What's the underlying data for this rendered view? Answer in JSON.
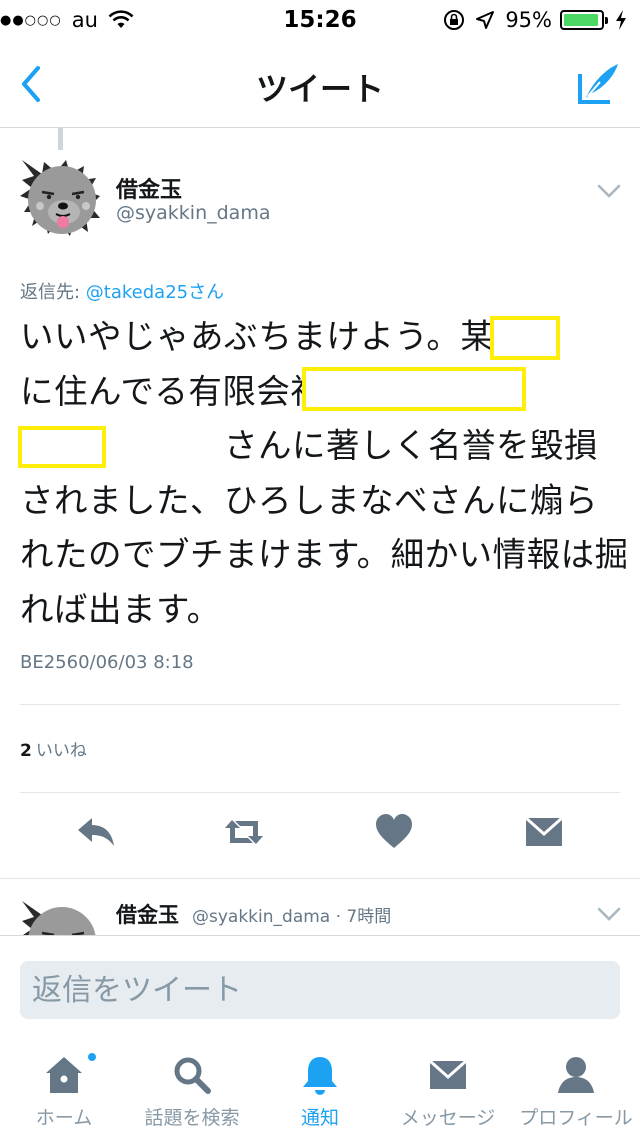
{
  "status_bar": {
    "signal": "●●○○○",
    "carrier": "au",
    "time": "15:26",
    "battery_percent": "95%",
    "battery_level": 0.95,
    "icons": [
      "wifi-icon",
      "rotation-lock-icon",
      "location-icon",
      "battery-icon",
      "charging-icon"
    ]
  },
  "nav": {
    "title": "ツイート",
    "back_icon": "chevron-left-icon",
    "compose_icon": "compose-tweet-icon"
  },
  "tweet": {
    "author_name": "借金玉",
    "author_handle": "@syakkin_dama",
    "reply_label": "返信先: ",
    "reply_mention": "@takeda25さん",
    "text": "いいやじゃあぶちまけよう。某　　　に住んでる有限会社　　　　　　　　　トの　　　　さんに著しく名誉を毀損されました、ひろしまなべさんに煽られたのでブチまけます。細かい情報は掘れば出ます。",
    "date": "BE2560/06/03 8:18",
    "likes_count": "2",
    "likes_label": "いいね",
    "actions": [
      "reply-icon",
      "retweet-icon",
      "heart-icon",
      "direct-message-icon"
    ]
  },
  "next_tweet": {
    "author_name": "借金玉",
    "meta": "@syakkin_dama · 7時間"
  },
  "reply_box": {
    "placeholder": "返信をツイート"
  },
  "tab_bar": {
    "items": [
      {
        "label": "ホーム",
        "icon": "home-icon"
      },
      {
        "label": "話題を検索",
        "icon": "search-icon"
      },
      {
        "label": "通知",
        "icon": "bell-icon",
        "active": true
      },
      {
        "label": "メッセージ",
        "icon": "envelope-icon"
      },
      {
        "label": "プロフィール",
        "icon": "person-icon"
      }
    ]
  },
  "colors": {
    "accent": "#1da1f2",
    "icon_gray": "#657786",
    "redaction": "#ffee0a",
    "battery": "#4cd964"
  }
}
